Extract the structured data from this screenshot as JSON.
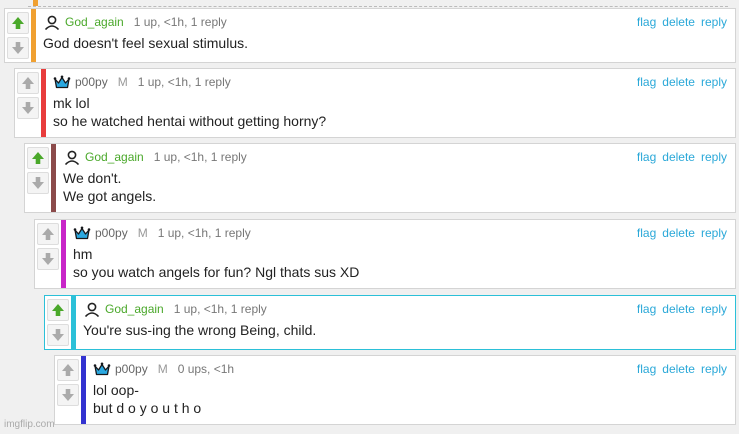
{
  "actions": {
    "flag": "flag",
    "delete": "delete",
    "reply": "reply"
  },
  "mod_badge": "M",
  "comments": [
    {
      "user": "God_again",
      "meta": "1 up, <1h, 1 reply",
      "strip_color": "#f0a030",
      "upvoted": true,
      "lines": [
        "God doesn't feel sexual stimulus."
      ]
    },
    {
      "user": "p00py",
      "meta": "1 up, <1h, 1 reply",
      "strip_color": "#e83c3c",
      "upvoted": false,
      "lines": [
        "mk lol",
        "so he watched hentai without getting horny?"
      ]
    },
    {
      "user": "God_again",
      "meta": "1 up, <1h, 1 reply",
      "strip_color": "#8b4a4a",
      "upvoted": true,
      "lines": [
        "We don't.",
        "We got angels."
      ]
    },
    {
      "user": "p00py",
      "meta": "1 up, <1h, 1 reply",
      "strip_color": "#c826c8",
      "upvoted": false,
      "lines": [
        "hm",
        "so you watch angels for fun? Ngl thats sus XD"
      ]
    },
    {
      "user": "God_again",
      "meta": "1 up, <1h, 1 reply",
      "strip_color": "#2bc0d8",
      "upvoted": true,
      "lines": [
        "You're sus-ing the wrong Being, child."
      ]
    },
    {
      "user": "p00py",
      "meta": "0 ups, <1h",
      "strip_color": "#3232d0",
      "upvoted": false,
      "lines": [
        "lol oop-",
        "but d o y o u t h o"
      ]
    }
  ],
  "watermark": "imgflip.com",
  "colors": {
    "upvote_green": "#4aa82a",
    "vote_gray": "#aaaaaa",
    "link_blue": "#2aa8d8"
  }
}
